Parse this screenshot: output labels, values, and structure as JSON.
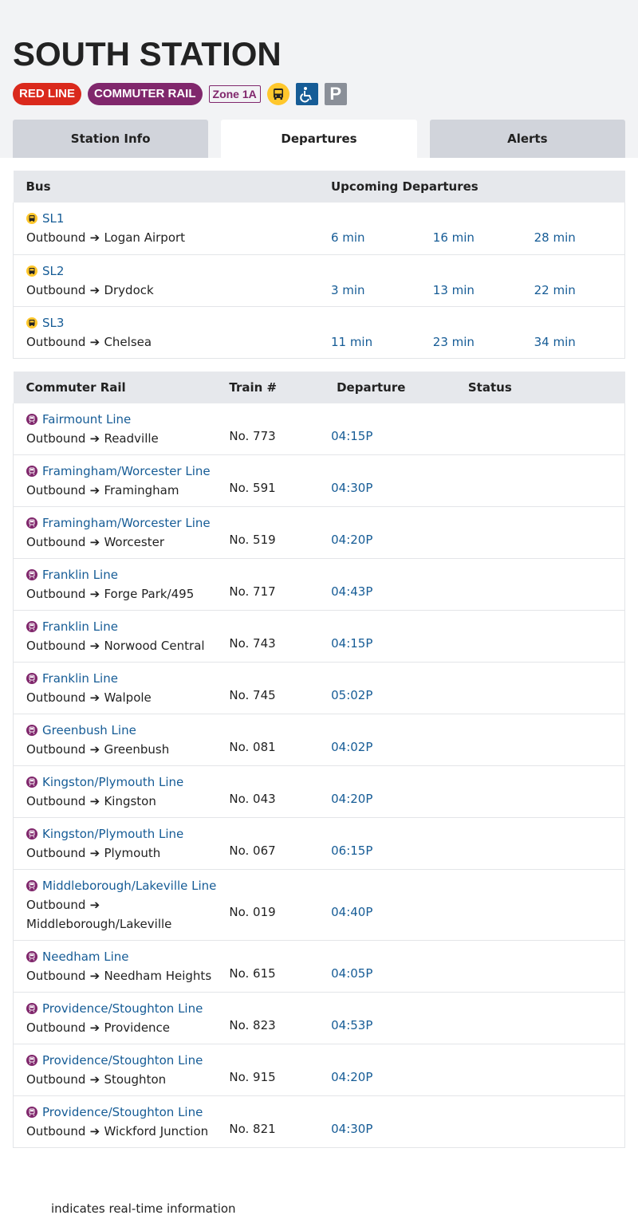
{
  "station": {
    "title": "SOUTH STATION"
  },
  "badges": {
    "red_line": "RED LINE",
    "commuter_rail": "COMMUTER RAIL",
    "zone": "Zone 1A"
  },
  "icons": [
    "bus-icon",
    "accessible-icon",
    "parking-icon"
  ],
  "colors": {
    "red_line": "#da291c",
    "commuter_rail": "#80276c",
    "bus": "#ffc72c",
    "link": "#165c96",
    "access": "#165c96"
  },
  "tabs": [
    {
      "label": "Station Info",
      "active": false
    },
    {
      "label": "Departures",
      "active": true
    },
    {
      "label": "Alerts",
      "active": false
    }
  ],
  "bus_table": {
    "headers": [
      "Bus",
      "Upcoming Departures"
    ],
    "rows": [
      {
        "route": "SL1",
        "direction": "Outbound",
        "destination": "Logan Airport",
        "times": [
          "6 min",
          "16 min",
          "28 min"
        ]
      },
      {
        "route": "SL2",
        "direction": "Outbound",
        "destination": "Drydock",
        "times": [
          "3 min",
          "13 min",
          "22 min"
        ]
      },
      {
        "route": "SL3",
        "direction": "Outbound",
        "destination": "Chelsea",
        "times": [
          "11 min",
          "23 min",
          "34 min"
        ]
      }
    ]
  },
  "rail_table": {
    "headers": [
      "Commuter Rail",
      "Train #",
      "Departure",
      "Status"
    ],
    "rows": [
      {
        "route": "Fairmount Line",
        "direction": "Outbound",
        "destination": "Readville",
        "train": "No. 773",
        "departure": "04:15P",
        "status": ""
      },
      {
        "route": "Framingham/Worcester Line",
        "direction": "Outbound",
        "destination": "Framingham",
        "train": "No. 591",
        "departure": "04:30P",
        "status": ""
      },
      {
        "route": "Framingham/Worcester Line",
        "direction": "Outbound",
        "destination": "Worcester",
        "train": "No. 519",
        "departure": "04:20P",
        "status": ""
      },
      {
        "route": "Franklin Line",
        "direction": "Outbound",
        "destination": "Forge Park/495",
        "train": "No. 717",
        "departure": "04:43P",
        "status": ""
      },
      {
        "route": "Franklin Line",
        "direction": "Outbound",
        "destination": "Norwood Central",
        "train": "No. 743",
        "departure": "04:15P",
        "status": ""
      },
      {
        "route": "Franklin Line",
        "direction": "Outbound",
        "destination": "Walpole",
        "train": "No. 745",
        "departure": "05:02P",
        "status": ""
      },
      {
        "route": "Greenbush Line",
        "direction": "Outbound",
        "destination": "Greenbush",
        "train": "No. 081",
        "departure": "04:02P",
        "status": ""
      },
      {
        "route": "Kingston/Plymouth Line",
        "direction": "Outbound",
        "destination": "Kingston",
        "train": "No. 043",
        "departure": "04:20P",
        "status": ""
      },
      {
        "route": "Kingston/Plymouth Line",
        "direction": "Outbound",
        "destination": "Plymouth",
        "train": "No. 067",
        "departure": "06:15P",
        "status": ""
      },
      {
        "route": "Middleborough/Lakeville Line",
        "direction": "Outbound",
        "destination": "Middleborough/Lakeville",
        "train": "No. 019",
        "departure": "04:40P",
        "status": ""
      },
      {
        "route": "Needham Line",
        "direction": "Outbound",
        "destination": "Needham Heights",
        "train": "No. 615",
        "departure": "04:05P",
        "status": ""
      },
      {
        "route": "Providence/Stoughton Line",
        "direction": "Outbound",
        "destination": "Providence",
        "train": "No. 823",
        "departure": "04:53P",
        "status": ""
      },
      {
        "route": "Providence/Stoughton Line",
        "direction": "Outbound",
        "destination": "Stoughton",
        "train": "No. 915",
        "departure": "04:20P",
        "status": ""
      },
      {
        "route": "Providence/Stoughton Line",
        "direction": "Outbound",
        "destination": "Wickford Junction",
        "train": "No. 821",
        "departure": "04:30P",
        "status": ""
      }
    ]
  },
  "footer": {
    "note": "indicates real-time information"
  }
}
